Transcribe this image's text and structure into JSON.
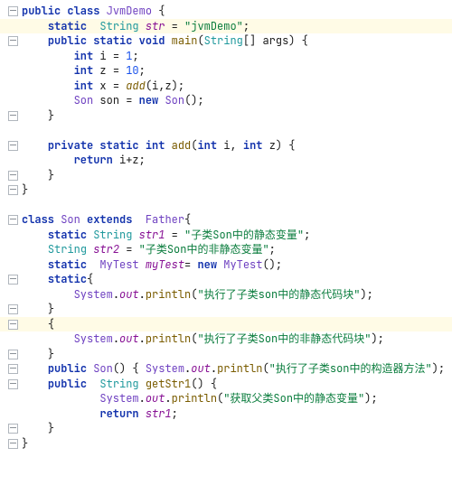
{
  "code": {
    "c1": {
      "kw1": "public",
      "kw2": "class",
      "cls": "JvmDemo",
      "p": " {"
    },
    "c2": {
      "kw1": "static",
      "type": "String",
      "fld": "str",
      "eq": " = ",
      "str": "\"jvmDemo\"",
      "p": ";"
    },
    "c3": {
      "kw1": "public",
      "kw2": "static",
      "kw3": "void",
      "mth": "main",
      "op": "(",
      "type": "String",
      "arr": "[]",
      "param": "args",
      "cp": ") {"
    },
    "c4": {
      "type": "int",
      "var": "i",
      "eq": " = ",
      "num": "1",
      "p": ";"
    },
    "c5": {
      "type": "int",
      "var": "z",
      "eq": " = ",
      "num": "10",
      "p": ";"
    },
    "c6": {
      "type": "int",
      "var": "x",
      "eq": " = ",
      "mth": "add",
      "args": "(i,z);"
    },
    "c7": {
      "cls": "Son",
      "var": "son",
      "eq": " = ",
      "kw": "new",
      "ctor": "Son",
      "p": "();"
    },
    "c8": {
      "p": "}"
    },
    "c9": {
      "kw1": "private",
      "kw2": "static",
      "type": "int",
      "mth": "add",
      "op": "(",
      "t1": "int",
      "a1": "i",
      "c": ", ",
      "t2": "int",
      "a2": "z",
      "cp": ") {"
    },
    "c10": {
      "kw": "return",
      "expr": " i+z;"
    },
    "c11": {
      "p": "}"
    },
    "c12": {
      "p": "}"
    },
    "s1": {
      "kw1": "class",
      "cls": "Son",
      "kw2": "extends",
      "sup": "Father",
      "p": "{"
    },
    "s2": {
      "kw": "static",
      "type": "String",
      "fld": "str1",
      "eq": " = ",
      "str": "\"子类Son中的静态变量\"",
      "p": ";"
    },
    "s3": {
      "type": "String",
      "fld": "str2",
      "eq": " = ",
      "str": "\"子类Son中的非静态变量\"",
      "p": ";"
    },
    "s4": {
      "kw": "static",
      "cls": "MyTest",
      "fld": "myTest",
      "eq": "= ",
      "kw2": "new",
      "ctor": "MyTest",
      "p": "();"
    },
    "s5": {
      "kw": "static",
      "p": "{"
    },
    "s6": {
      "cls": "System",
      "dot": ".",
      "out": "out",
      "dot2": ".",
      "mth": "println",
      "op": "(",
      "str": "\"执行了子类son中的静态代码块\"",
      "cp": ");"
    },
    "s7": {
      "p": "}"
    },
    "s8": {
      "p": "{"
    },
    "s9": {
      "cls": "System",
      "dot": ".",
      "out": "out",
      "dot2": ".",
      "mth": "println",
      "op": "(",
      "str": "\"执行了子类Son中的非静态代码块\"",
      "cp": ");"
    },
    "s10": {
      "p": "}"
    },
    "s11": {
      "kw": "public",
      "ctor": "Son",
      "paren": "()",
      "ob": " { ",
      "cls": "System",
      "dot": ".",
      "out": "out",
      "dot2": ".",
      "mth": "println",
      "op": "(",
      "str": "\"执行了子类son中的构造器方法\"",
      "cp": "); }"
    },
    "s12": {
      "kw": "public",
      "type": "String",
      "mth": "getStr1",
      "paren": "()",
      "ob": " {"
    },
    "s13": {
      "cls": "System",
      "dot": ".",
      "out": "out",
      "dot2": ".",
      "mth": "println",
      "op": "(",
      "str": "\"获取父类Son中的静态变量\"",
      "cp": ");"
    },
    "s14": {
      "kw": "return",
      "sp": " ",
      "fld": "str1",
      "p": ";"
    },
    "s15": {
      "p": "}"
    },
    "s16": {
      "p": "}"
    }
  }
}
